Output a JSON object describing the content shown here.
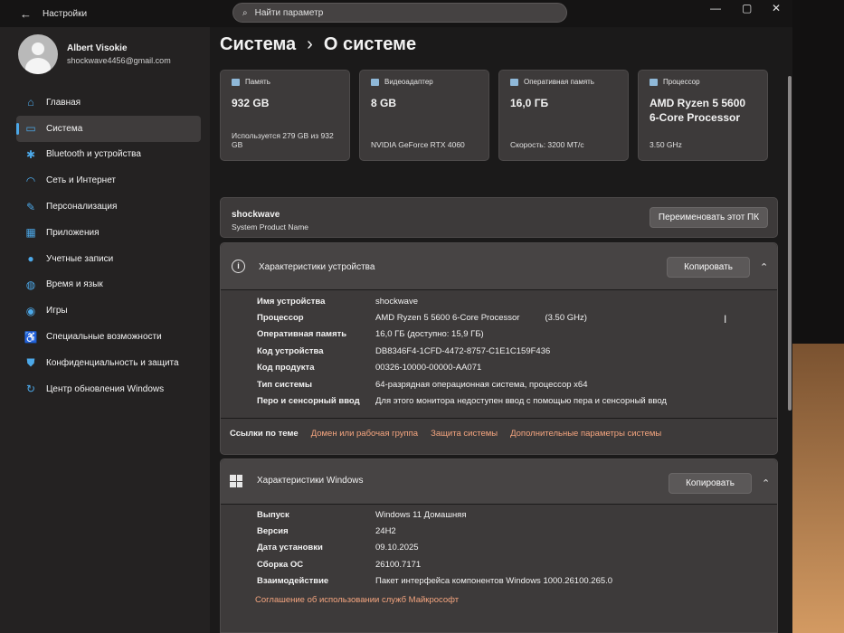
{
  "titlebar": {
    "back": "←",
    "title": "Настройки",
    "search_placeholder": "Найти параметр",
    "min": "—",
    "max": "▢",
    "close": "✕"
  },
  "profile": {
    "name": "Albert Visokie",
    "email": "shockwave4456@gmail.com"
  },
  "nav": [
    {
      "label": "Главная",
      "icon": "home-icon",
      "glyph": "⌂"
    },
    {
      "label": "Система",
      "icon": "monitor-icon",
      "glyph": "▭",
      "active": true
    },
    {
      "label": "Bluetooth и устройства",
      "icon": "bluetooth-icon",
      "glyph": "✱"
    },
    {
      "label": "Сеть и Интернет",
      "icon": "wifi-icon",
      "glyph": "◠"
    },
    {
      "label": "Персонализация",
      "icon": "brush-icon",
      "glyph": "✎"
    },
    {
      "label": "Приложения",
      "icon": "apps-icon",
      "glyph": "▦"
    },
    {
      "label": "Учетные записи",
      "icon": "user-icon",
      "glyph": "●"
    },
    {
      "label": "Время и язык",
      "icon": "globe-icon",
      "glyph": "◍"
    },
    {
      "label": "Игры",
      "icon": "gamepad-icon",
      "glyph": "◉"
    },
    {
      "label": "Специальные возможности",
      "icon": "accessibility-icon",
      "glyph": "♿"
    },
    {
      "label": "Конфиденциальность и защита",
      "icon": "shield-icon",
      "glyph": "⛊"
    },
    {
      "label": "Центр обновления Windows",
      "icon": "update-icon",
      "glyph": "↻"
    }
  ],
  "breadcrumb": {
    "parent": "Система",
    "sep": "›",
    "current": "О системе"
  },
  "cards": [
    {
      "title": "Память",
      "value": "932 GB",
      "sub": "Используется 279 GB из 932 GB"
    },
    {
      "title": "Видеоадаптер",
      "value": "8 GB",
      "sub": "NVIDIA GeForce RTX 4060"
    },
    {
      "title": "Оперативная память",
      "value": "16,0 ГБ",
      "sub": "Скорость: 3200 MT/c"
    },
    {
      "title": "Процессор",
      "value": "AMD Ryzen 5 5600 6-Core Processor",
      "sub": "3.50 GHz"
    }
  ],
  "device": {
    "name": "shockwave",
    "sub": "System Product Name",
    "rename": "Переименовать этот ПК"
  },
  "specs": {
    "title": "Характеристики устройства",
    "copy": "Копировать",
    "rows": [
      {
        "k": "Имя устройства",
        "v": "shockwave"
      },
      {
        "k": "Процессор",
        "v": "AMD Ryzen 5 5600 6-Core Processor",
        "extra": "(3.50 GHz)"
      },
      {
        "k": "Оперативная память",
        "v": "16,0 ГБ (доступно: 15,9 ГБ)"
      },
      {
        "k": "Код устройства",
        "v": "DB8346F4-1CFD-4472-8757-C1E1C159F436"
      },
      {
        "k": "Код продукта",
        "v": "00326-10000-00000-AA071"
      },
      {
        "k": "Тип системы",
        "v": "64-разрядная операционная система, процессор x64"
      },
      {
        "k": "Перо и сенсорный ввод",
        "v": "Для этого монитора недоступен ввод с помощью пера и сенсорный ввод"
      }
    ],
    "links_label": "Ссылки по теме",
    "links": [
      "Домен или рабочая группа",
      "Защита системы",
      "Дополнительные параметры системы"
    ]
  },
  "windows": {
    "title": "Характеристики Windows",
    "copy": "Копировать",
    "rows": [
      {
        "k": "Выпуск",
        "v": "Windows 11 Домашняя"
      },
      {
        "k": "Версия",
        "v": "24H2"
      },
      {
        "k": "Дата установки",
        "v": "09.10.2025"
      },
      {
        "k": "Сборка ОС",
        "v": "26100.7171"
      },
      {
        "k": "Взаимодействие",
        "v": "Пакет интерфейса компонентов Windows 1000.26100.265.0"
      }
    ],
    "link": "Соглашение об использовании служб Майкрософт"
  }
}
